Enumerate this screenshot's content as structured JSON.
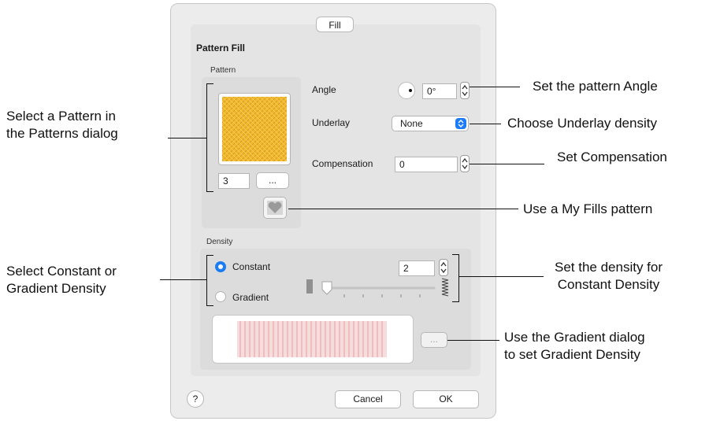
{
  "dialog": {
    "tab_label": "Fill",
    "section_title": "Pattern Fill",
    "pattern_group_label": "Pattern",
    "pattern_number": "3",
    "more_button_label": "...",
    "angle_label": "Angle",
    "angle_value": "0°",
    "underlay_label": "Underlay",
    "underlay_value": "None",
    "compensation_label": "Compensation",
    "compensation_value": "0",
    "density_group_label": "Density",
    "constant_label": "Constant",
    "gradient_label": "Gradient",
    "selected_density": "Constant",
    "density_value": "2",
    "gradient_more_label": "...",
    "help_label": "?",
    "cancel_label": "Cancel",
    "ok_label": "OK"
  },
  "callouts": {
    "select_pattern": "Select a Pattern in\nthe Patterns dialog",
    "select_density": "Select Constant or\nGradient Density",
    "set_angle": "Set the pattern Angle",
    "choose_underlay": "Choose Underlay density",
    "set_compensation": "Set Compensation",
    "my_fills": "Use a My Fills pattern",
    "constant_density": "Set the density for\nConstant Density",
    "gradient_dialog": "Use the Gradient dialog\nto set Gradient Density"
  },
  "colors": {
    "accent": "#1b7cf5",
    "pattern_swatch": "#f2b92c",
    "gradient_stripes": "#e9a7a7"
  }
}
